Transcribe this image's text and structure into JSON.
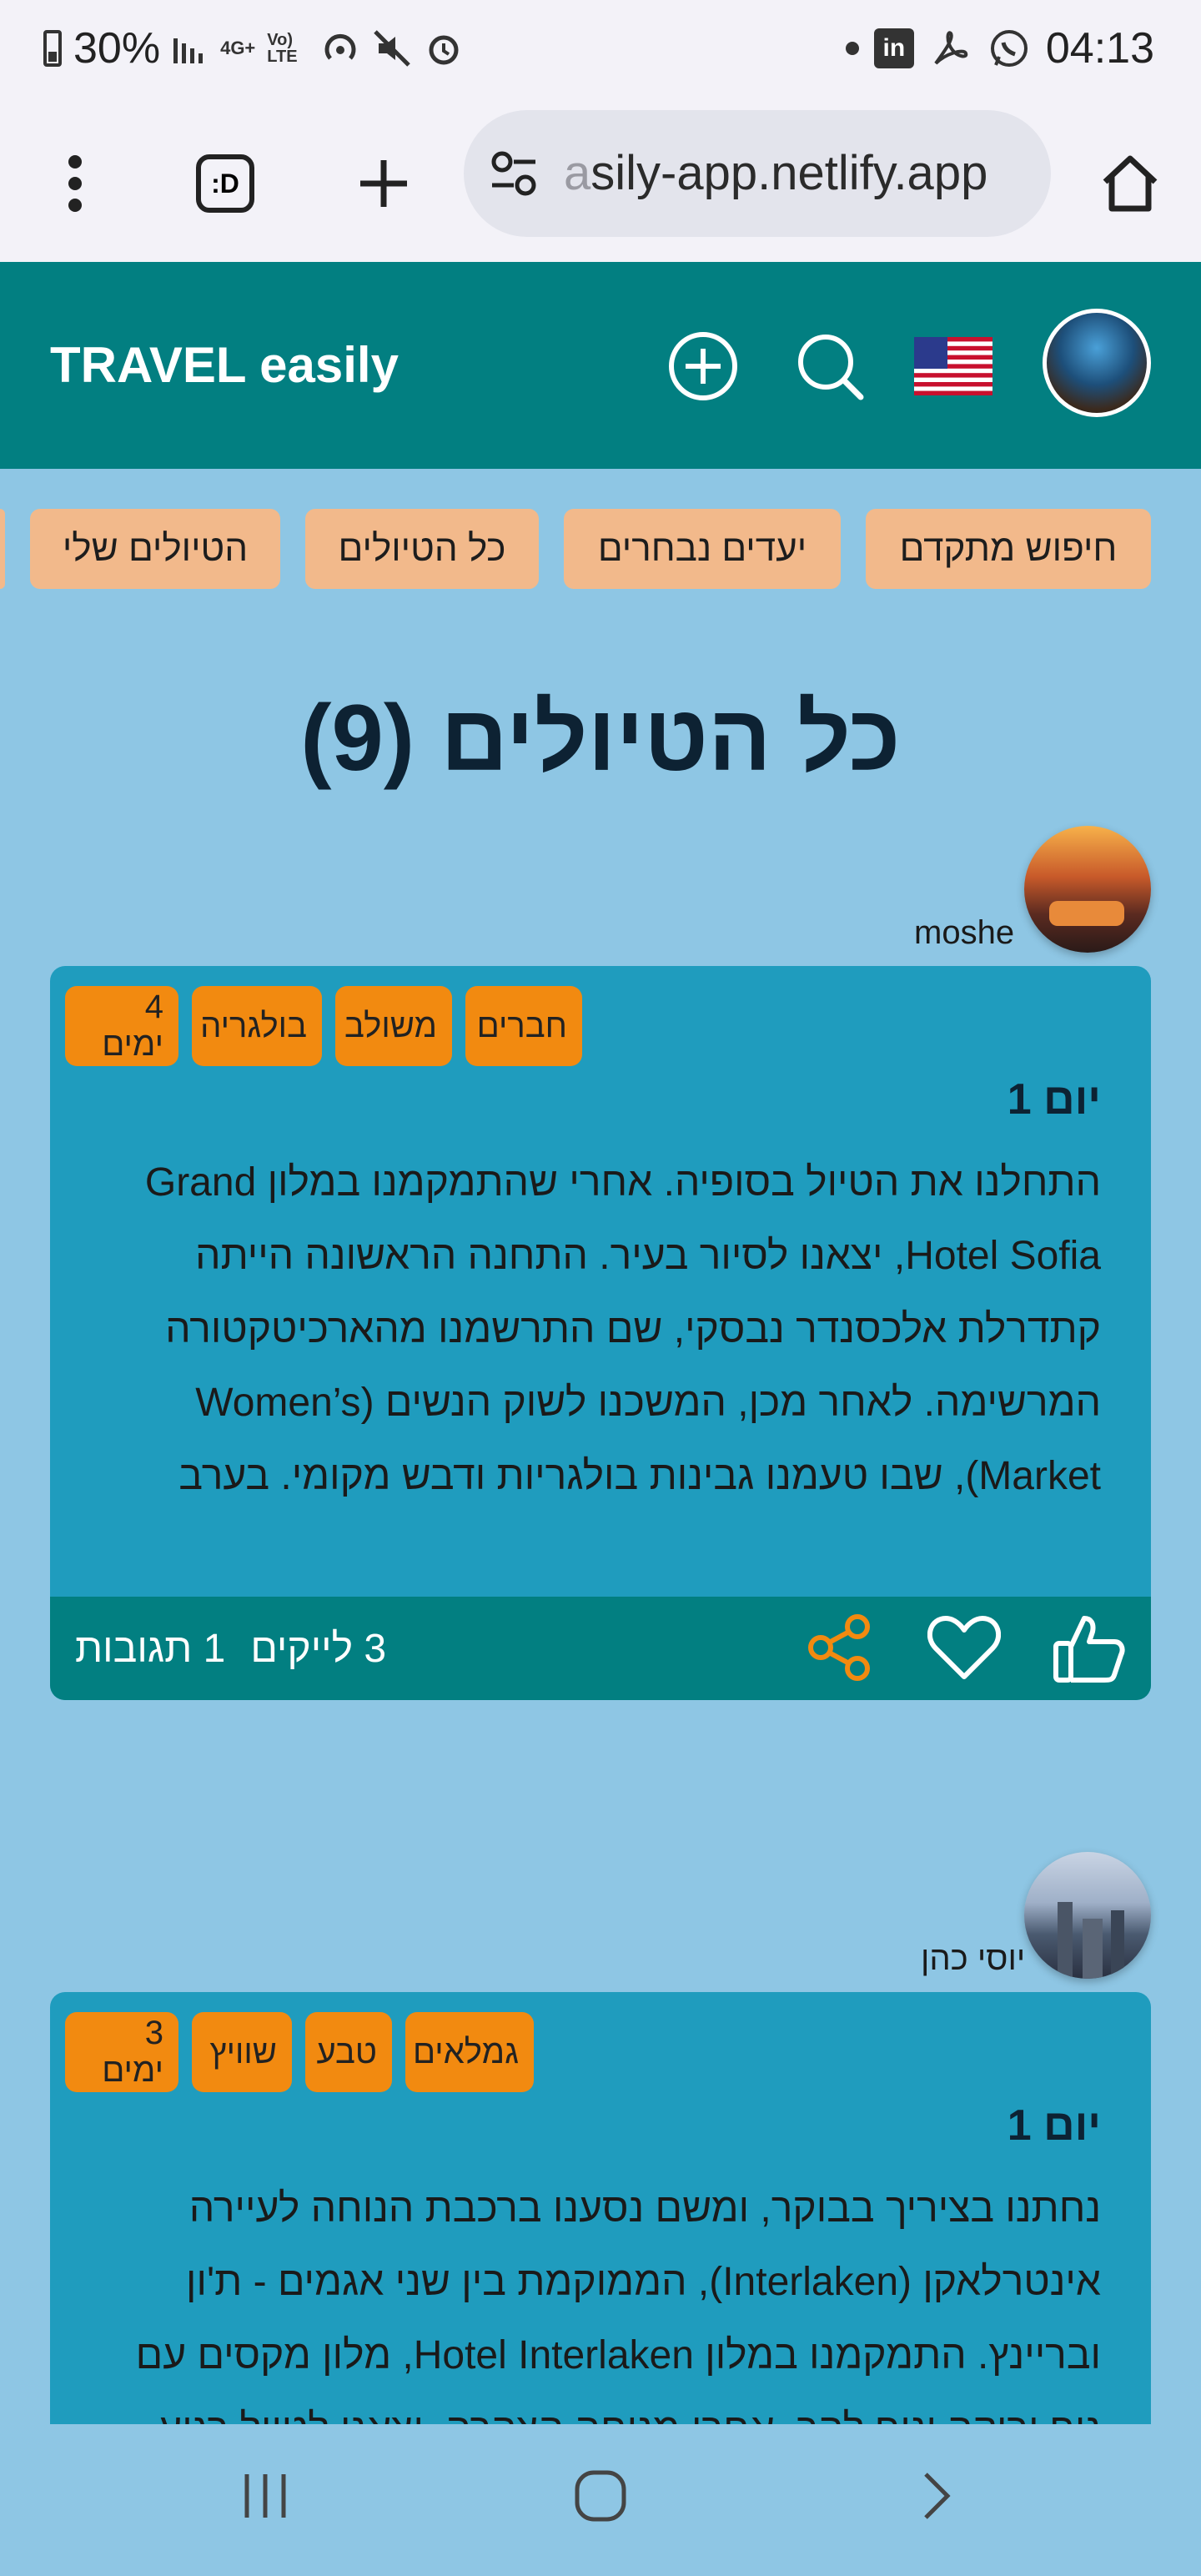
{
  "status_bar": {
    "battery": "30%",
    "network": "4G+",
    "volte": "Vo) LTE",
    "time": "04:13",
    "linkedin_label": "in"
  },
  "browser": {
    "url_fade": "a",
    "url": "sily-app.netlify.app",
    "tab_glyph": ":D"
  },
  "app": {
    "title": "TRAVEL easily",
    "nav": [
      "חיפוש מתקדם",
      "יעדים נבחרים",
      "כל הטיולים",
      "הטיולים שלי"
    ],
    "page_title": "כל הטיולים (9)"
  },
  "trips": [
    {
      "author": "moshe",
      "tags": [
        "חברים",
        "משולב",
        "בולגריה",
        "4 ימים"
      ],
      "day_label": "יום 1",
      "text": "התחלנו את הטיול בסופיה. אחרי שהתמקמנו במלון Grand Hotel Sofia, יצאנו לסיור בעיר. התחנה הראשונה הייתה קתדרלת אלכסנדר נבסקי, שם התרשמנו מהארכיטקטורה המרשימה. לאחר מכן, המשכנו לשוק הנשים (Women’s Market), שבו טעמנו גבינות בולגריות ודבש מקומי. בערב",
      "likes": "3 לייקים",
      "comments": "1 תגובות"
    },
    {
      "author": "יוסי כהן",
      "tags": [
        "גמלאים",
        "טבע",
        "שוויץ",
        "3 ימים"
      ],
      "day_label": "יום 1",
      "text": "נחתנו בציריך בבוקר, ומשם נסענו ברכבת הנוחה לעיירה אינטרלאקן (Interlaken), הממוקמת בין שני אגמים - ת'ון ובריינץ. התמקמנו במלון Hotel Interlaken, מלון מקסים עם נוף ירוקה ונוף להר. אחרי מנוחה הצהרה, יצאנו לטיול רגוע"
    }
  ],
  "colors": {
    "header": "#027f81",
    "background": "#8ec6e4",
    "card": "#1f9cbe",
    "tag": "#f28a10",
    "nav_pill": "#f2b98b"
  }
}
